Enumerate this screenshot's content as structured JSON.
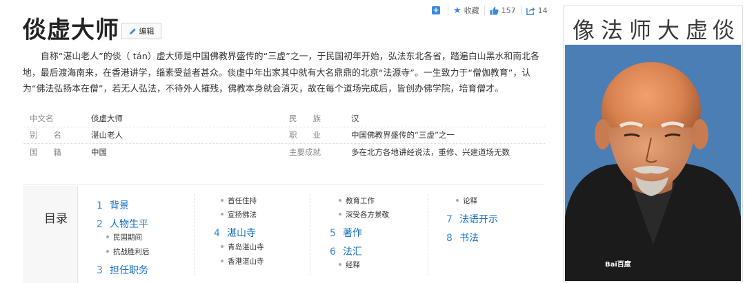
{
  "toolbar": {
    "collect_label": "收藏",
    "like_count": "157",
    "share_count": "14"
  },
  "title": "倓虚大师",
  "edit_label": "编辑",
  "summary": "自称“湛山老人”的倓（ tán）虚大师是中国佛教界盛传的“三虚”之一，于民国初年开始，弘法东北各省，踏遍白山黑水和南北各地，最后渡海南来，在香港讲学，缁素受益者甚众。倓虚中年出家其中就有大名鼎鼎的北京“法源寺”。一生致力于“僧伽教育”，认为“佛法弘扬本在僧”，若无人弘法，不待外人摧残，佛教本身就会消灭，故在每个道场完成后，皆创办佛学院，培育僧才。",
  "basic_info": [
    {
      "label": "中文名",
      "value": "倓虚大师",
      "label2": "民　　族",
      "value2": "汉"
    },
    {
      "label": "别　　名",
      "value": "湛山老人",
      "label2": "职　　业",
      "value2": "中国佛教界盛传的“三虚”之一"
    },
    {
      "label": "国　　籍",
      "value": "中国",
      "label2": "主要成就",
      "value2": "多在北方各地讲经说法，重修、兴建道场无数"
    }
  ],
  "toc": {
    "title": "目录",
    "items": [
      {
        "num": "1",
        "label": "背景"
      },
      {
        "num": "2",
        "label": "人物生平"
      },
      {
        "sub": "民国期间"
      },
      {
        "sub": "抗战胜利后"
      },
      {
        "num": "3",
        "label": "担任职务"
      },
      {
        "sub": "首任住持"
      },
      {
        "sub": "宣扬佛法"
      },
      {
        "num": "4",
        "label": "湛山寺"
      },
      {
        "sub": "青岛湛山寺"
      },
      {
        "sub": "香港湛山寺"
      },
      {
        "sub": "教育工作"
      },
      {
        "sub": "深受各方景敬"
      },
      {
        "num": "5",
        "label": "著作"
      },
      {
        "num": "6",
        "label": "法汇"
      },
      {
        "sub": "经释"
      },
      {
        "sub": "论释"
      },
      {
        "num": "7",
        "label": "法语开示"
      },
      {
        "num": "8",
        "label": "书法"
      }
    ]
  },
  "portrait": {
    "calligraphy": [
      "像",
      "法",
      "师",
      "大",
      "虚",
      "倓"
    ],
    "watermark": "Bai百度"
  },
  "colors": {
    "link": "#136ec2",
    "accent": "#3b8ad9",
    "photo_bg": "#4a7eb5"
  }
}
